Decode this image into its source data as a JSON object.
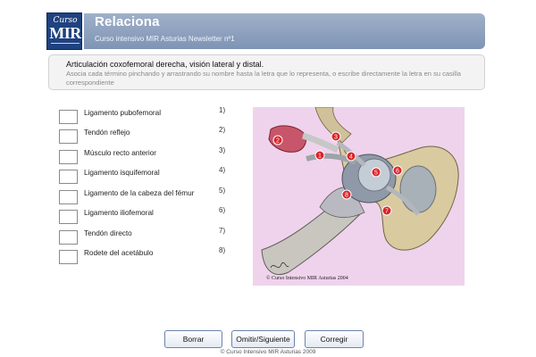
{
  "header": {
    "logo_script": "Curso",
    "logo_text": "MIR",
    "title": "Relaciona",
    "subtitle": "Curso intensivo MIR Asturias Newsletter nº1"
  },
  "instructions": {
    "title": "Articulación coxofemoral derecha, visión lateral y distal.",
    "text": "Asocia cada término pinchando y arrastrando su nombre hasta la letra que lo representa, o escribe directamente la letra en su casilla correspondiente"
  },
  "terms": [
    {
      "label": "Ligamento pubofemoral",
      "number": "1)"
    },
    {
      "label": "Tendón reflejo",
      "number": "2)"
    },
    {
      "label": "Músculo recto anterior",
      "number": "3)"
    },
    {
      "label": "Ligamento isquifemoral",
      "number": "4)"
    },
    {
      "label": "Ligamento de la cabeza del fémur",
      "number": "5)"
    },
    {
      "label": "Ligamento iliofemoral",
      "number": "6)"
    },
    {
      "label": "Tendón directo",
      "number": "7)"
    },
    {
      "label": "Rodete del acetábulo",
      "number": "8)"
    }
  ],
  "illustration": {
    "markers": [
      "1",
      "2",
      "3",
      "4",
      "5",
      "6",
      "7",
      "8"
    ],
    "copyright": "© Curso Intensivo MIR Asturias 2004"
  },
  "buttons": {
    "clear": "Borrar",
    "skip_next": "Omitir/Siguiente",
    "check": "Corregir"
  },
  "footer": "© Curso Intensivo MIR Asturias 2009",
  "colors": {
    "header_bar": "#8fa3c2",
    "logo_bg": "#1f4280",
    "marker_red": "#d9252a",
    "illustration_bg": "#efd3ec"
  }
}
